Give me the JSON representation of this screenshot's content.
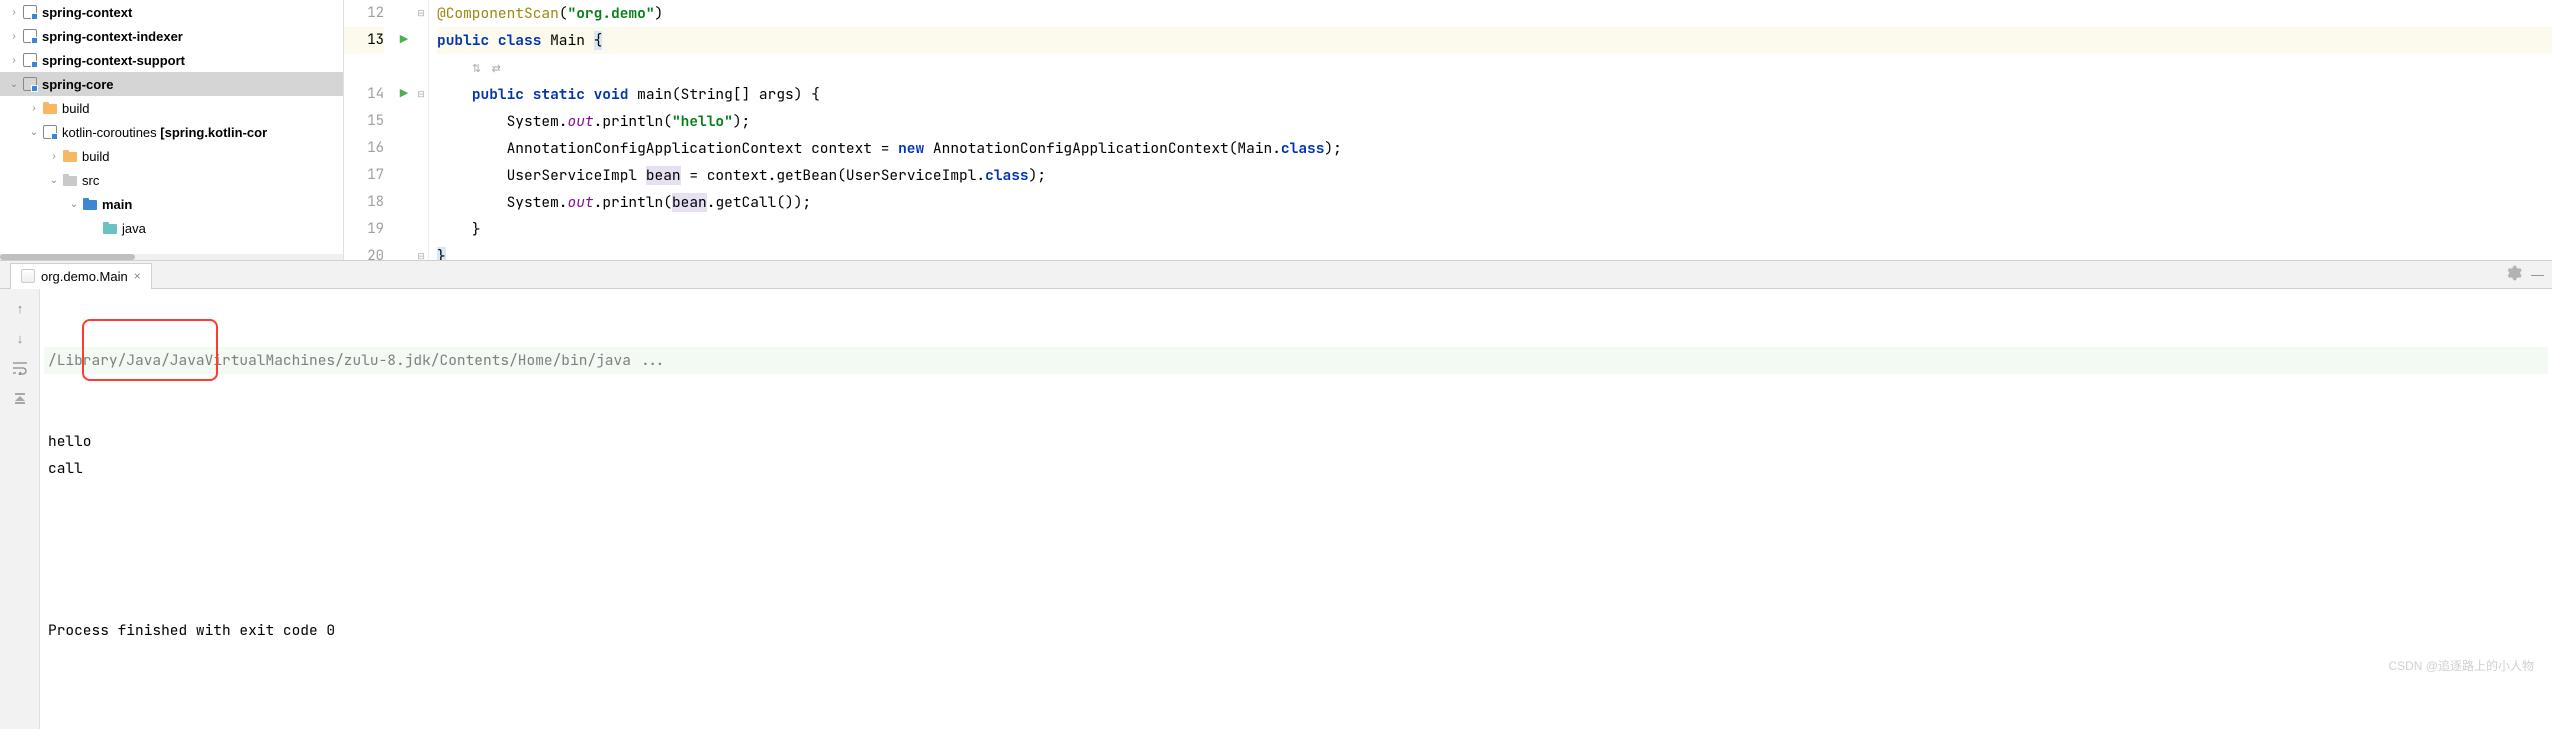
{
  "tree": {
    "items": [
      {
        "indent": 0,
        "arrow": "right",
        "icon": "module",
        "label": "spring-context",
        "bold": true
      },
      {
        "indent": 0,
        "arrow": "right",
        "icon": "module",
        "label": "spring-context-indexer",
        "bold": true
      },
      {
        "indent": 0,
        "arrow": "right",
        "icon": "module",
        "label": "spring-context-support",
        "bold": true
      },
      {
        "indent": 0,
        "arrow": "down",
        "icon": "module",
        "label": "spring-core",
        "bold": true,
        "selected": true
      },
      {
        "indent": 1,
        "arrow": "right",
        "icon": "folder-orange",
        "label": "build",
        "bold": false
      },
      {
        "indent": 1,
        "arrow": "down",
        "icon": "module",
        "label": "kotlin-coroutines",
        "bold": false,
        "suffix": " [spring.kotlin-cor",
        "suffixBold": true
      },
      {
        "indent": 2,
        "arrow": "right",
        "icon": "folder-orange",
        "label": "build",
        "bold": false
      },
      {
        "indent": 2,
        "arrow": "down",
        "icon": "folder-gray",
        "label": "src",
        "bold": false
      },
      {
        "indent": 3,
        "arrow": "down",
        "icon": "folder-blue",
        "label": "main",
        "bold": true
      },
      {
        "indent": 4,
        "arrow": "",
        "icon": "folder-teal",
        "label": "java",
        "bold": false
      }
    ]
  },
  "editor": {
    "lines": [
      {
        "num": 12,
        "run": false,
        "fold": "minus",
        "tokens": [
          {
            "t": "@ComponentScan",
            "c": "ann"
          },
          {
            "t": "(",
            "c": ""
          },
          {
            "t": "\"org.demo\"",
            "c": "str"
          },
          {
            "t": ")",
            "c": ""
          }
        ],
        "indent": 0
      },
      {
        "num": 13,
        "run": true,
        "fold": "",
        "current": true,
        "tokens": [
          {
            "t": "public class ",
            "c": "kw"
          },
          {
            "t": "Main ",
            "c": "cls"
          },
          {
            "t": "{",
            "c": "brace-hl"
          }
        ],
        "indent": 0
      },
      {
        "num": "",
        "run": false,
        "fold": "",
        "tokens": [
          {
            "t": "⇅ ⇄",
            "c": "hint"
          }
        ],
        "indent": 1
      },
      {
        "num": 14,
        "run": true,
        "fold": "minus",
        "tokens": [
          {
            "t": "public static void ",
            "c": "kw"
          },
          {
            "t": "main(String[] args) {",
            "c": ""
          }
        ],
        "indent": 1
      },
      {
        "num": 15,
        "run": false,
        "fold": "",
        "tokens": [
          {
            "t": "System.",
            "c": ""
          },
          {
            "t": "out",
            "c": "fld"
          },
          {
            "t": ".println(",
            "c": ""
          },
          {
            "t": "\"hello\"",
            "c": "str"
          },
          {
            "t": ");",
            "c": ""
          }
        ],
        "indent": 2
      },
      {
        "num": 16,
        "run": false,
        "fold": "",
        "tokens": [
          {
            "t": "AnnotationConfigApplicationContext context = ",
            "c": ""
          },
          {
            "t": "new ",
            "c": "kw"
          },
          {
            "t": "AnnotationConfigApplicationContext(Main.",
            "c": ""
          },
          {
            "t": "class",
            "c": "kw"
          },
          {
            "t": ");",
            "c": ""
          }
        ],
        "indent": 2
      },
      {
        "num": 17,
        "run": false,
        "fold": "",
        "tokens": [
          {
            "t": "UserServiceImpl ",
            "c": ""
          },
          {
            "t": "bean",
            "c": "usage-hl"
          },
          {
            "t": " = context.getBean(UserServiceImpl.",
            "c": ""
          },
          {
            "t": "class",
            "c": "kw"
          },
          {
            "t": ");",
            "c": ""
          }
        ],
        "indent": 2
      },
      {
        "num": 18,
        "run": false,
        "fold": "",
        "tokens": [
          {
            "t": "System.",
            "c": ""
          },
          {
            "t": "out",
            "c": "fld"
          },
          {
            "t": ".println(",
            "c": ""
          },
          {
            "t": "bean",
            "c": "usage-hl"
          },
          {
            "t": ".getCall());",
            "c": ""
          }
        ],
        "indent": 2
      },
      {
        "num": 19,
        "run": false,
        "fold": "",
        "tokens": [
          {
            "t": "}",
            "c": ""
          }
        ],
        "indent": 1
      },
      {
        "num": 20,
        "run": false,
        "fold": "minus",
        "tokens": [
          {
            "t": "}",
            "c": "brace-hl"
          }
        ],
        "indent": 0
      }
    ]
  },
  "run": {
    "tab_label": "org.demo.Main",
    "cmd": "/Library/Java/JavaVirtualMachines/zulu-8.jdk/Contents/Home/bin/java ...",
    "output": [
      "hello",
      "call"
    ],
    "exit": "Process finished with exit code 0"
  },
  "watermark": "CSDN @追逐路上的小人物"
}
